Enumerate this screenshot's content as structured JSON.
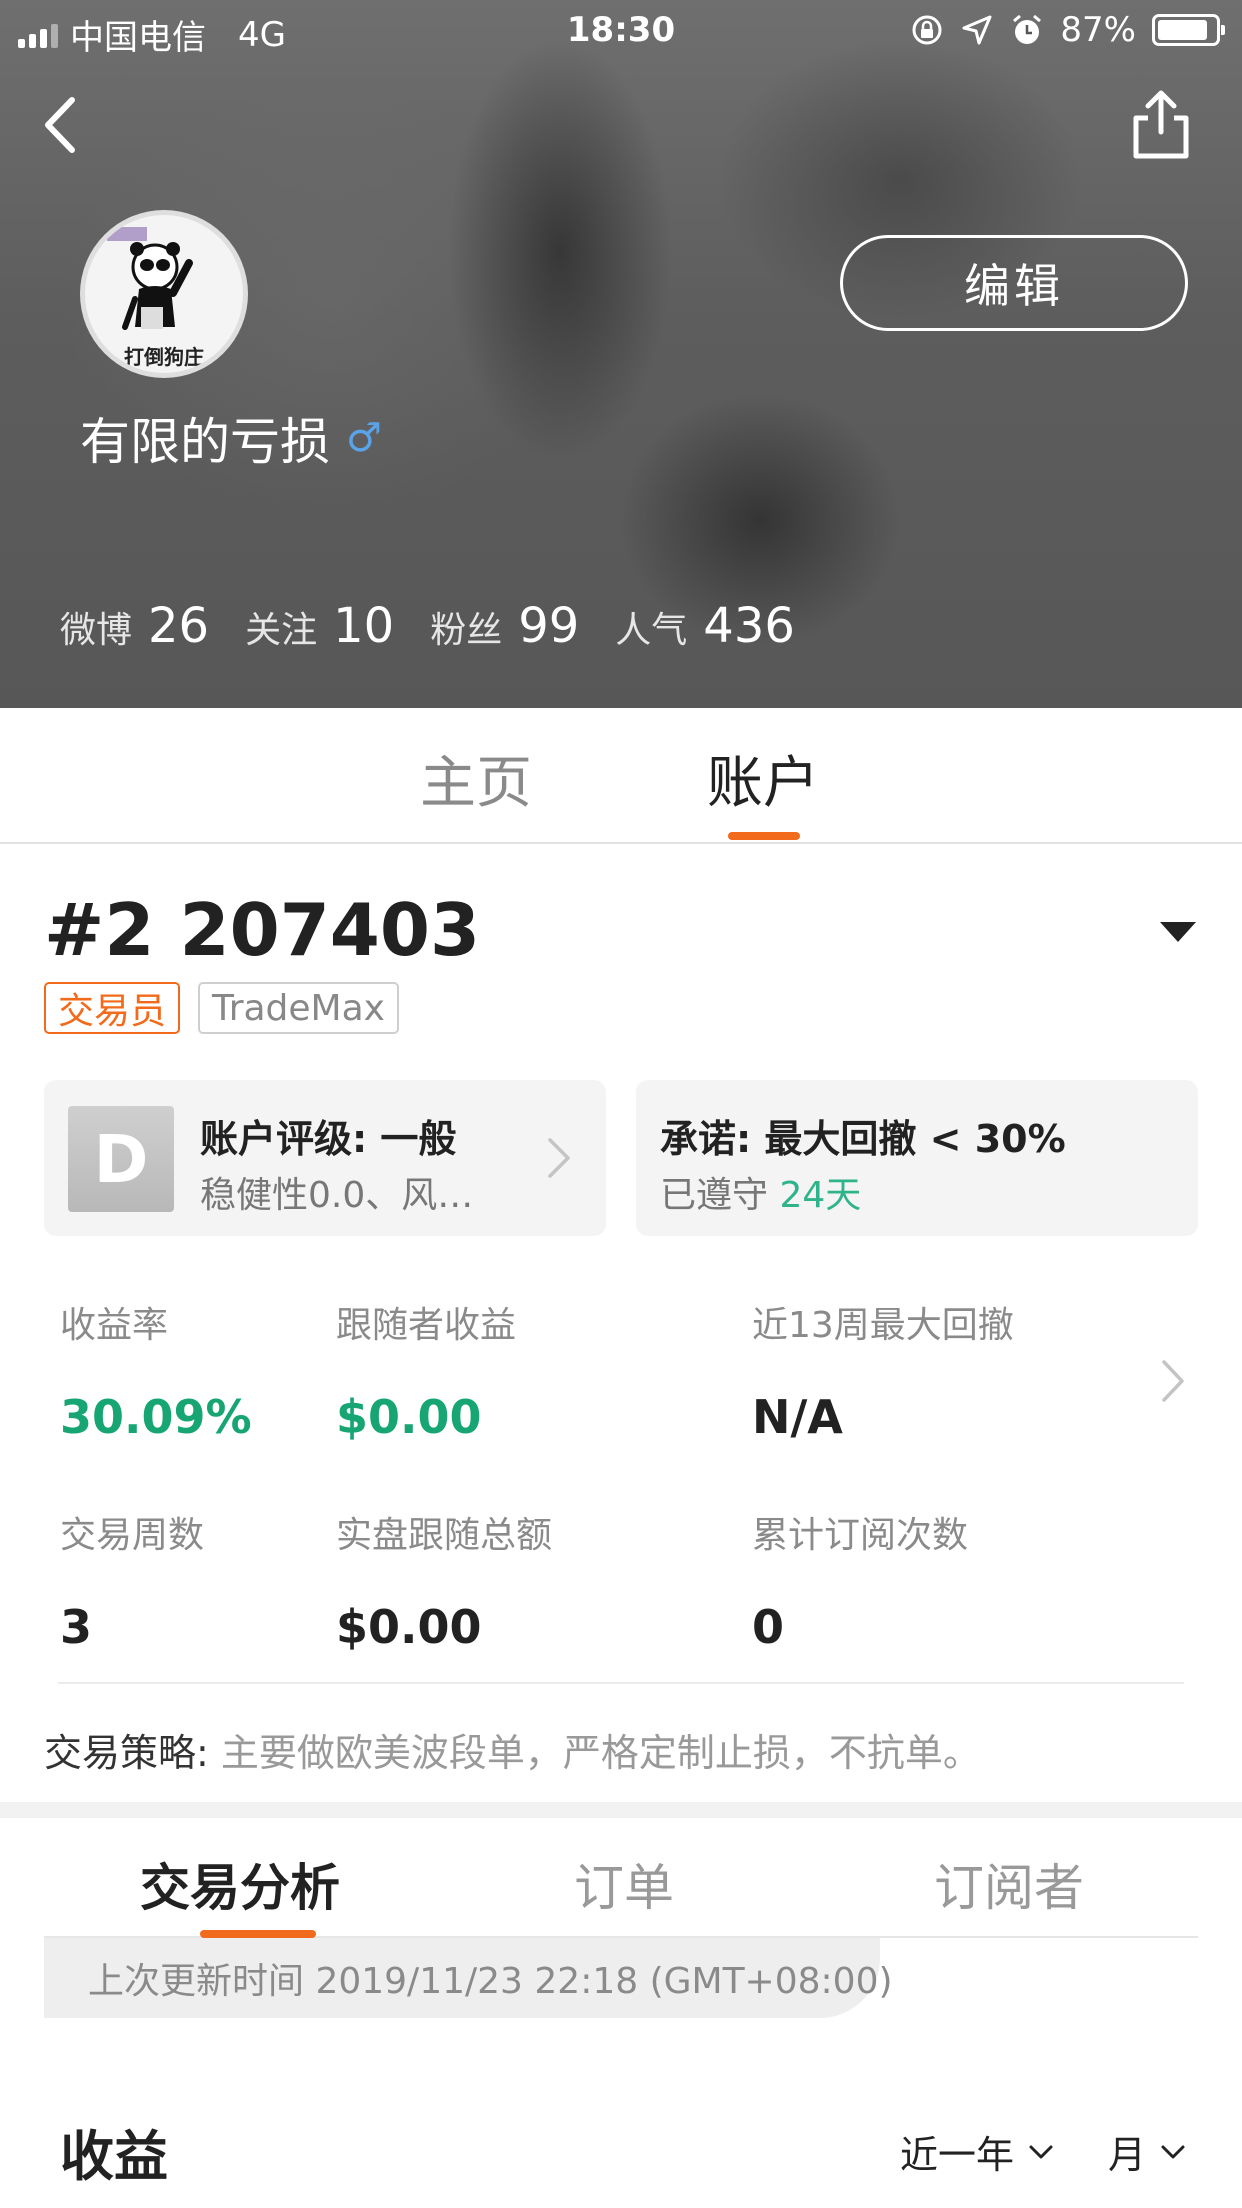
{
  "status_bar": {
    "carrier": "中国电信",
    "network": "4G",
    "time": "18:30",
    "battery": "87%",
    "battery_level": 0.87
  },
  "profile": {
    "avatar_caption": "打倒狗庄",
    "edit_label": "编辑",
    "username": "有限的亏损",
    "gender_symbol": "♂",
    "stats": [
      {
        "label": "微博",
        "value": "26"
      },
      {
        "label": "关注",
        "value": "10"
      },
      {
        "label": "粉丝",
        "value": "99"
      },
      {
        "label": "人气",
        "value": "436"
      }
    ]
  },
  "profile_tabs": {
    "home": "主页",
    "account": "账户",
    "active": "account"
  },
  "account": {
    "title": "#2 207403",
    "tags": {
      "trader": "交易员",
      "platform": "TradeMax"
    },
    "rating": {
      "badge": "D",
      "title": "账户评级: 一般",
      "subtitle": "稳健性0.0、风…"
    },
    "promise": {
      "title": "承诺: 最大回撤 < 30%",
      "prefix": "已遵守",
      "days": "24天"
    },
    "metrics": [
      {
        "label": "收益率",
        "value": "30.09%"
      },
      {
        "label": "跟随者收益",
        "value": "$0.00"
      },
      {
        "label": "近13周最大回撤",
        "value": "N/A"
      },
      {
        "label": "交易周数",
        "value": "3"
      },
      {
        "label": "实盘跟随总额",
        "value": "$0.00"
      },
      {
        "label": "累计订阅次数",
        "value": "0"
      }
    ],
    "strategy_label": "交易策略:",
    "strategy_text": " 主要做欧美波段单，严格定制止损，不抗单。"
  },
  "sub_tabs": {
    "analysis": "交易分析",
    "orders": "订单",
    "subscribers": "订阅者",
    "active": "analysis"
  },
  "update_text": "上次更新时间 2019/11/23 22:18 (GMT+08:00)",
  "income": {
    "title": "收益",
    "range_filter": "近一年",
    "period_filter": "月"
  },
  "colors": {
    "accent": "#f26a1b",
    "positive": "#17a673",
    "teal": "#2fb38a",
    "gender": "#5aa3e8"
  }
}
